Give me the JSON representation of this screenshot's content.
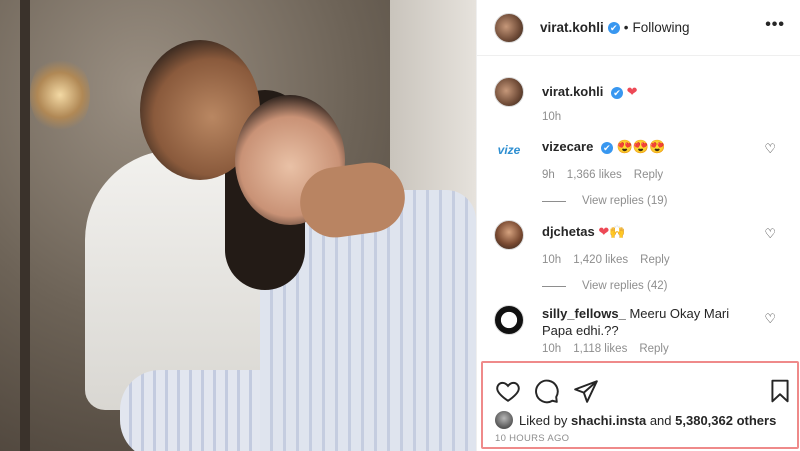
{
  "post": {
    "image_alt": ""
  },
  "header": {
    "username": "virat.kohli",
    "verified_mark": "✔",
    "separator": "•",
    "follow_status": "Following",
    "more": "•••"
  },
  "comments": [
    {
      "username": "virat.kohli",
      "text": "",
      "emoji": "❤",
      "time": "10h",
      "likes": "",
      "reply_label": "",
      "view_replies": ""
    },
    {
      "username": "vizecare",
      "avatar_text": "vize",
      "text": "😍😍😍",
      "time": "9h",
      "likes": "1,366 likes",
      "reply_label": "Reply",
      "view_replies": "View replies (19)"
    },
    {
      "username": "djchetas",
      "text": "❤🙌",
      "time": "10h",
      "likes": "1,420 likes",
      "reply_label": "Reply",
      "view_replies": "View replies (42)"
    },
    {
      "username": "silly_fellows_",
      "text": "Meeru Okay Mari Papa edhi.??",
      "time": "10h",
      "likes": "1,118 likes",
      "reply_label": "Reply"
    }
  ],
  "likes": {
    "prefix": "Liked by",
    "user": "shachi.insta",
    "joiner": "and",
    "others": "5,380,362 others"
  },
  "timestamp": "10 HOURS AGO",
  "colors": {
    "verified": "#3897f0",
    "highlight_border": "#ef8a8a",
    "meta_text": "#8e8e8e"
  },
  "icons": [
    "heart-icon",
    "comment-icon",
    "share-icon",
    "bookmark-icon"
  ]
}
